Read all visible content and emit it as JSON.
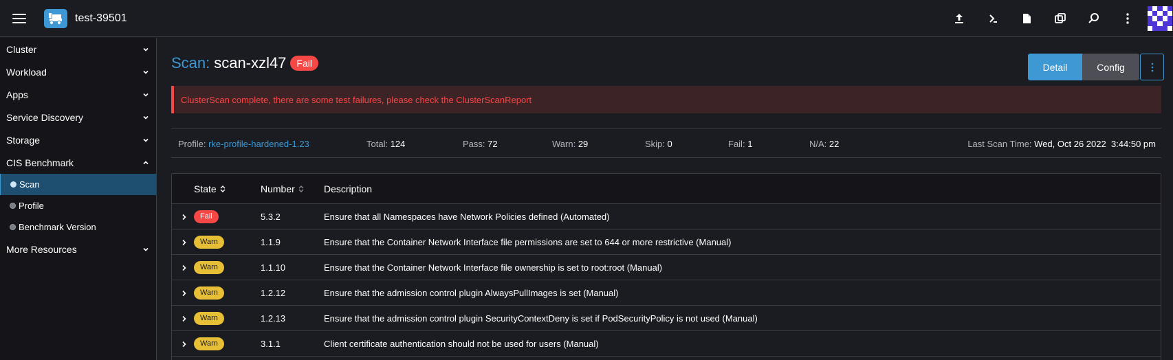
{
  "header": {
    "cluster_name": "test-39501",
    "icons": [
      "hamburger-icon",
      "cluster-logo-icon",
      "import-yaml-icon",
      "kubectl-shell-icon",
      "kubeconfig-file-icon",
      "copy-kubeconfig-icon",
      "search-icon",
      "more-vertical-icon",
      "avatar"
    ]
  },
  "sidebar": {
    "groups": [
      {
        "label": "Cluster"
      },
      {
        "label": "Workload"
      },
      {
        "label": "Apps"
      },
      {
        "label": "Service Discovery"
      },
      {
        "label": "Storage"
      },
      {
        "label": "CIS Benchmark"
      },
      {
        "label": "More Resources"
      }
    ],
    "sub_items": [
      {
        "label": "Scan",
        "active": true
      },
      {
        "label": "Profile",
        "active": false
      },
      {
        "label": "Benchmark Version",
        "active": false
      }
    ]
  },
  "title": {
    "prefix": "Scan:",
    "name": "scan-xzl47",
    "status": "Fail"
  },
  "buttons": {
    "detail": "Detail",
    "config": "Config"
  },
  "banner": {
    "message": "ClusterScan complete, there are some test failures, please check the ClusterScanReport"
  },
  "stats": {
    "profile_label": "Profile:",
    "profile_value": "rke-profile-hardened-1.23",
    "total_label": "Total:",
    "total_value": "124",
    "pass_label": "Pass:",
    "pass_value": "72",
    "warn_label": "Warn:",
    "warn_value": "29",
    "skip_label": "Skip:",
    "skip_value": "0",
    "fail_label": "Fail:",
    "fail_value": "1",
    "na_label": "N/A:",
    "na_value": "22",
    "last_scan_label": "Last Scan Time:",
    "last_scan_value": "Wed, Oct 26 2022  3:44:50 pm"
  },
  "table": {
    "columns": {
      "state": "State",
      "number": "Number",
      "description": "Description"
    },
    "rows": [
      {
        "state": "Fail",
        "number": "5.3.2",
        "description": "Ensure that all Namespaces have Network Policies defined (Automated)"
      },
      {
        "state": "Warn",
        "number": "1.1.9",
        "description": "Ensure that the Container Network Interface file permissions are set to 644 or more restrictive (Manual)"
      },
      {
        "state": "Warn",
        "number": "1.1.10",
        "description": "Ensure that the Container Network Interface file ownership is set to root:root (Manual)"
      },
      {
        "state": "Warn",
        "number": "1.2.12",
        "description": "Ensure that the admission control plugin AlwaysPullImages is set (Manual)"
      },
      {
        "state": "Warn",
        "number": "1.2.13",
        "description": "Ensure that the admission control plugin SecurityContextDeny is set if PodSecurityPolicy is not used (Manual)"
      },
      {
        "state": "Warn",
        "number": "3.1.1",
        "description": "Client certificate authentication should not be used for users (Manual)"
      }
    ]
  },
  "colors": {
    "accent": "#3d98d3",
    "fail": "#f64747",
    "warn": "#e7bf37",
    "background": "#1b1c21",
    "sidebar": "#141419"
  }
}
